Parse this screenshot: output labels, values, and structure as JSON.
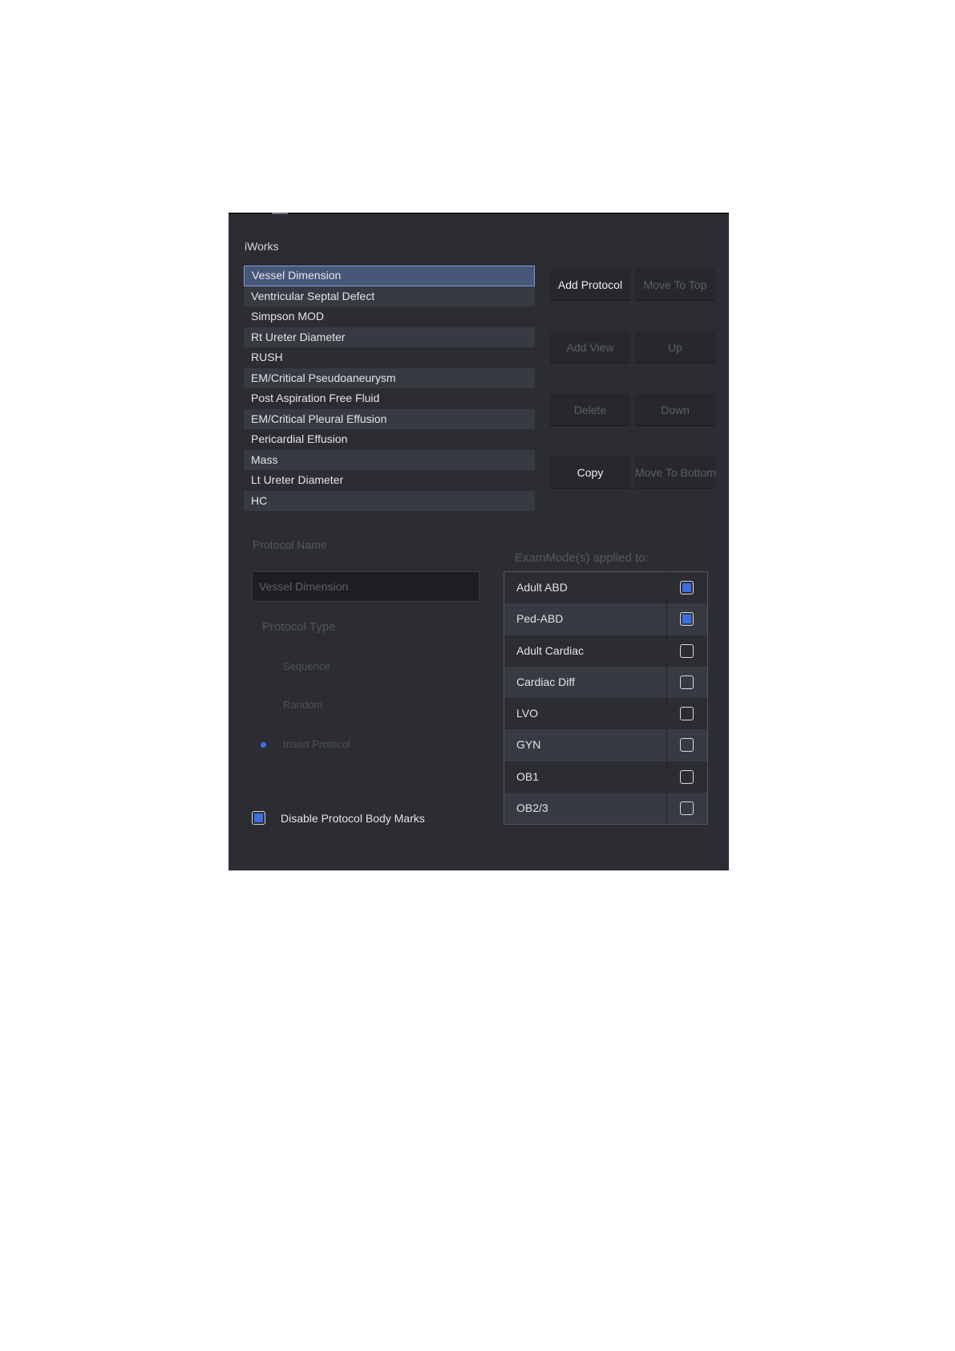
{
  "panel": {
    "title": "iWorks"
  },
  "protocols": [
    {
      "label": "Vessel Dimension",
      "selected": true
    },
    {
      "label": "Ventricular Septal Defect"
    },
    {
      "label": "Simpson MOD"
    },
    {
      "label": "Rt Ureter Diameter"
    },
    {
      "label": "RUSH"
    },
    {
      "label": "EM/Critical Pseudoaneurysm"
    },
    {
      "label": "Post Aspiration Free Fluid"
    },
    {
      "label": "EM/Critical Pleural Effusion"
    },
    {
      "label": "Pericardial Effusion"
    },
    {
      "label": "Mass"
    },
    {
      "label": "Lt Ureter Diameter"
    },
    {
      "label": "HC"
    }
  ],
  "buttons": {
    "add_protocol": {
      "label": "Add Protocol",
      "enabled": true
    },
    "move_to_top": {
      "label": "Move To Top",
      "enabled": false
    },
    "add_view": {
      "label": "Add View",
      "enabled": false
    },
    "up": {
      "label": "Up",
      "enabled": false
    },
    "delete": {
      "label": "Delete",
      "enabled": false
    },
    "down": {
      "label": "Down",
      "enabled": false
    },
    "copy": {
      "label": "Copy",
      "enabled": true
    },
    "move_to_bottom": {
      "label": "Move To Bottom",
      "enabled": false
    }
  },
  "protocol_name": {
    "label": "Protocol Name",
    "value": "Vessel Dimension"
  },
  "protocol_type": {
    "label": "Protocol Type",
    "options": [
      {
        "label": "Sequence",
        "selected": false
      },
      {
        "label": "Random",
        "selected": false
      },
      {
        "label": "Insert Protocol",
        "selected": true
      }
    ]
  },
  "exam_modes": {
    "label": "ExamMode(s) applied to:",
    "items": [
      {
        "label": "Adult ABD",
        "checked": true
      },
      {
        "label": "Ped-ABD",
        "checked": true
      },
      {
        "label": "Adult Cardiac",
        "checked": false
      },
      {
        "label": "Cardiac Diff",
        "checked": false
      },
      {
        "label": "LVO",
        "checked": false
      },
      {
        "label": "GYN",
        "checked": false
      },
      {
        "label": "OB1",
        "checked": false
      },
      {
        "label": "OB2/3",
        "checked": false
      }
    ]
  },
  "disable_body_marks": {
    "label": "Disable Protocol Body Marks",
    "checked": true
  },
  "colors": {
    "panel_bg": "#2b2d33",
    "accent": "#3b6fe0",
    "selected_row": "#46577a"
  }
}
